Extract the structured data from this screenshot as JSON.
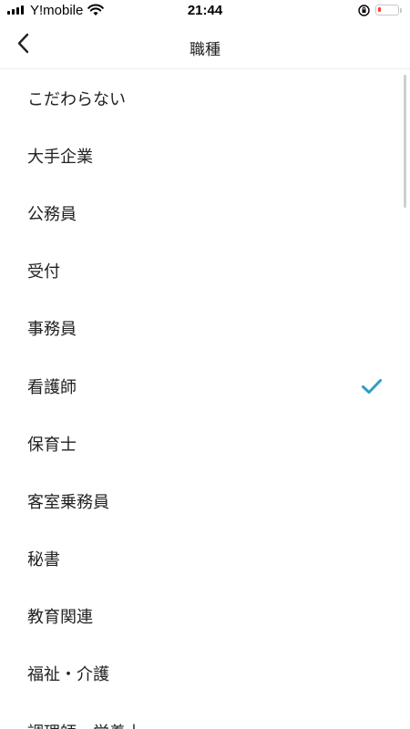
{
  "status_bar": {
    "carrier": "Y!mobile",
    "time": "21:44"
  },
  "header": {
    "title": "職種"
  },
  "list": {
    "items": [
      {
        "label": "こだわらない",
        "selected": false
      },
      {
        "label": "大手企業",
        "selected": false
      },
      {
        "label": "公務員",
        "selected": false
      },
      {
        "label": "受付",
        "selected": false
      },
      {
        "label": "事務員",
        "selected": false
      },
      {
        "label": "看護師",
        "selected": true
      },
      {
        "label": "保育士",
        "selected": false
      },
      {
        "label": "客室乗務員",
        "selected": false
      },
      {
        "label": "秘書",
        "selected": false
      },
      {
        "label": "教育関連",
        "selected": false
      },
      {
        "label": "福祉・介護",
        "selected": false
      },
      {
        "label": "調理師・栄養士",
        "selected": false
      }
    ]
  },
  "colors": {
    "accent": "#2a9fc7",
    "battery_low": "#ff3b30"
  },
  "icons": {
    "back": "chevron-left-icon",
    "selected": "checkmark-icon"
  }
}
